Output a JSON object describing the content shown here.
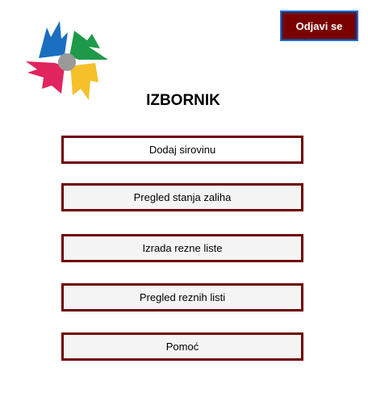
{
  "header": {
    "logout_label": "Odjavi se"
  },
  "menu": {
    "title": "IZBORNIK",
    "items": [
      {
        "label": "Dodaj sirovinu"
      },
      {
        "label": "Pregled stanja zaliha"
      },
      {
        "label": "Izrada rezne liste"
      },
      {
        "label": "Pregled reznih listi"
      },
      {
        "label": "Pomoć"
      }
    ]
  },
  "colors": {
    "button_border": "#6e0000",
    "logout_bg": "#7a0000",
    "logout_border": "#1f6fd0",
    "logo_blue": "#1a6fc0",
    "logo_green": "#1e9a4a",
    "logo_yellow": "#f5c02a",
    "logo_pink": "#e0245e",
    "logo_center": "#9a9a9a"
  },
  "icons": {
    "logo": "company-logo-icon"
  }
}
